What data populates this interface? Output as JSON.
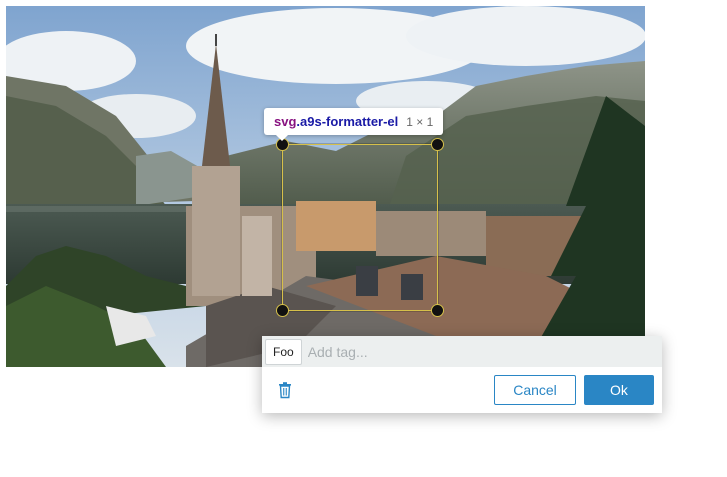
{
  "tooltip": {
    "tag": "svg",
    "class_name": ".a9s-formatter-el",
    "dimensions": "1 × 1"
  },
  "annotation_editor": {
    "tags": [
      "Foo"
    ],
    "tag_input_placeholder": "Add tag...",
    "cancel_label": "Cancel",
    "ok_label": "Ok",
    "delete_icon": "trash-icon"
  },
  "colors": {
    "accent": "#2a86c5",
    "selection_outline": "#d6c04a",
    "tooltip_tag": "#881280",
    "tooltip_class": "#1a1aa6"
  }
}
